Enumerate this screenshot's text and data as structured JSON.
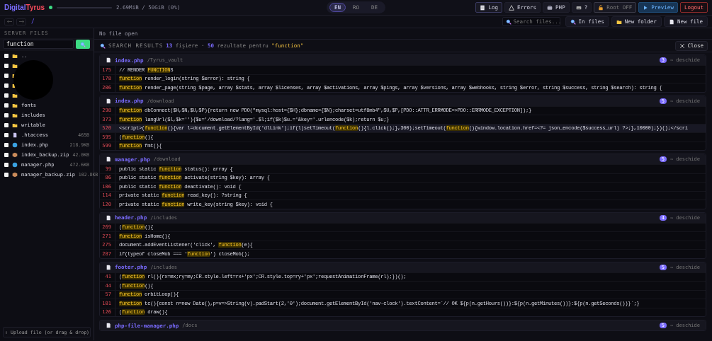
{
  "topbar": {
    "logo": {
      "first": "Digital",
      "second": "Tyrus"
    },
    "status_online": true,
    "storage": {
      "level": 0.0,
      "reading": "2.69MiB / 50GiB (0%)"
    },
    "languages": [
      {
        "label": "EN",
        "selected": true
      },
      {
        "label": "RO",
        "selected": false
      },
      {
        "label": "DE",
        "selected": false
      }
    ],
    "buttons": [
      {
        "label": "Log",
        "kind": "outline"
      },
      {
        "label": "Errors",
        "kind": "plain"
      },
      {
        "label": "PHP",
        "kind": "plain"
      },
      {
        "label": "?",
        "kind": "plain"
      },
      {
        "label": "Root OFF",
        "kind": "muted"
      },
      {
        "label": "Preview",
        "kind": "primary"
      },
      {
        "label": "Logout",
        "kind": "danger"
      }
    ]
  },
  "toolbar": {
    "path": "/",
    "search": {
      "placeholder": "Search files..."
    },
    "buttons": [
      {
        "label": "In files"
      },
      {
        "label": "New folder"
      },
      {
        "label": "New file"
      }
    ]
  },
  "sidebar": {
    "title": "SERVER FILES",
    "search": {
      "value": "function"
    },
    "files": [
      {
        "name": "..",
        "kind": "folder",
        "checked": false
      },
      {
        "kind": "folder",
        "checked": false
      },
      {
        "kind": "folder",
        "checked": false
      },
      {
        "kind": "folder",
        "checked": false
      },
      {
        "kind": "folder",
        "checked": false
      },
      {
        "name": "fonts",
        "kind": "folder",
        "checked": false
      },
      {
        "name": "includes",
        "kind": "folder",
        "checked": false
      },
      {
        "name": "writable",
        "kind": "folder",
        "checked": false
      },
      {
        "name": ".htaccess",
        "kind": "file",
        "size": "465B",
        "checked": false
      },
      {
        "name": "index.php",
        "kind": "php",
        "size": "218.9KB",
        "checked": false
      },
      {
        "name": "index_backup.zip",
        "kind": "zip",
        "size": "42.0KB",
        "checked": false
      },
      {
        "name": "manager.php",
        "kind": "php",
        "size": "472.6KB",
        "checked": false
      },
      {
        "name": "manager_backup.zip",
        "kind": "zip",
        "size": "102.8KB",
        "checked": false
      }
    ],
    "upload": "⇧ Upload file (or drag & drop)"
  },
  "editor": {
    "status": "No file open"
  },
  "search_results": {
    "title": "SEARCH RESULTS",
    "file_count": "13",
    "files_text": "fișiere ·",
    "result_count": "50",
    "results_text": "rezultate pentru",
    "query": "\"function\"",
    "close": "Close",
    "groups": [
      {
        "file": "index.php",
        "path": "/Tyrus_vault",
        "count": "3",
        "open": "→ deschide",
        "lines": [
          {
            "number": "175",
            "selected": false,
            "parts": [
              {
                "text": "// RENDER ",
                "match": false
              },
              {
                "text": "FUNCTION",
                "match": true
              },
              {
                "text": "S",
                "match": false
              }
            ]
          },
          {
            "number": "178",
            "selected": false,
            "parts": [
              {
                "text": "function",
                "match": true
              },
              {
                "text": " render_login(string $error): string {",
                "match": false
              }
            ]
          },
          {
            "number": "206",
            "selected": false,
            "parts": [
              {
                "text": "function",
                "match": true
              },
              {
                "text": " render_page(string $page, array $stats, array $licenses, array $activations, array $pings, array $versions, array $webhooks, string $error, string $success, string $search): string {",
                "match": false
              }
            ]
          }
        ]
      },
      {
        "file": "index.php",
        "path": "/download",
        "count": "5",
        "open": "→ deschide",
        "lines": [
          {
            "number": "298",
            "selected": false,
            "parts": [
              {
                "text": "function",
                "match": true
              },
              {
                "text": " dbConnect($H,$N,$U,$P){return new PDO(\"mysql:host={$H};dbname={$N};charset=utf8mb4\",$U,$P,[PDO::ATTR_ERRMODE=>PDO::ERRMODE_EXCEPTION]);}",
                "match": false
              }
            ]
          },
          {
            "number": "373",
            "selected": false,
            "parts": [
              {
                "text": "function",
                "match": true
              },
              {
                "text": " langUrl($l,$k=''){$u='/download/?lang='.$l;if($k)$u.='&key='.urlencode($k);return $u;}",
                "match": false
              }
            ]
          },
          {
            "number": "520",
            "selected": true,
            "parts": [
              {
                "text": "<script>(",
                "match": false
              },
              {
                "text": "function",
                "match": true
              },
              {
                "text": "(){var l=document.getElementById('dlLink');if(l)setTimeout(",
                "match": false
              },
              {
                "text": "function",
                "match": true
              },
              {
                "text": "(){l.click();},300);setTimeout(",
                "match": false
              },
              {
                "text": "function",
                "match": true
              },
              {
                "text": "(){window.location.href=<?= json_encode($success_url) ?>;},10000);})();</scri",
                "match": false
              }
            ]
          },
          {
            "number": "595",
            "selected": false,
            "parts": [
              {
                "text": "(",
                "match": false
              },
              {
                "text": "function",
                "match": true
              },
              {
                "text": "(){",
                "match": false
              }
            ]
          },
          {
            "number": "599",
            "selected": false,
            "parts": [
              {
                "text": "function",
                "match": true
              },
              {
                "text": " fmt(){",
                "match": false
              }
            ]
          }
        ]
      },
      {
        "file": "manager.php",
        "path": "/download",
        "count": "5",
        "open": "→ deschide",
        "lines": [
          {
            "number": "39",
            "selected": false,
            "parts": [
              {
                "text": "public static ",
                "match": false
              },
              {
                "text": "function",
                "match": true
              },
              {
                "text": " status(): array {",
                "match": false
              }
            ]
          },
          {
            "number": "86",
            "selected": false,
            "parts": [
              {
                "text": "public static ",
                "match": false
              },
              {
                "text": "function",
                "match": true
              },
              {
                "text": " activate(string $key): array {",
                "match": false
              }
            ]
          },
          {
            "number": "106",
            "selected": false,
            "parts": [
              {
                "text": "public static ",
                "match": false
              },
              {
                "text": "function",
                "match": true
              },
              {
                "text": " deactivate(): void {",
                "match": false
              }
            ]
          },
          {
            "number": "114",
            "selected": false,
            "parts": [
              {
                "text": "private static ",
                "match": false
              },
              {
                "text": "function",
                "match": true
              },
              {
                "text": " read_key(): ?string {",
                "match": false
              }
            ]
          },
          {
            "number": "120",
            "selected": false,
            "parts": [
              {
                "text": "private static ",
                "match": false
              },
              {
                "text": "function",
                "match": true
              },
              {
                "text": " write_key(string $key): void {",
                "match": false
              }
            ]
          }
        ]
      },
      {
        "file": "header.php",
        "path": "/includes",
        "count": "4",
        "open": "→ deschide",
        "lines": [
          {
            "number": "269",
            "selected": false,
            "parts": [
              {
                "text": "(",
                "match": false
              },
              {
                "text": "function",
                "match": true
              },
              {
                "text": "(){",
                "match": false
              }
            ]
          },
          {
            "number": "271",
            "selected": false,
            "parts": [
              {
                "text": "function",
                "match": true
              },
              {
                "text": " isHome(){",
                "match": false
              }
            ]
          },
          {
            "number": "275",
            "selected": false,
            "parts": [
              {
                "text": "document.addEventListener('click', ",
                "match": false
              },
              {
                "text": "function",
                "match": true
              },
              {
                "text": "(e){",
                "match": false
              }
            ]
          },
          {
            "number": "287",
            "selected": false,
            "parts": [
              {
                "text": "if(typeof closeMob === '",
                "match": false
              },
              {
                "text": "function",
                "match": true
              },
              {
                "text": "') closeMob();",
                "match": false
              }
            ]
          }
        ]
      },
      {
        "file": "footer.php",
        "path": "/includes",
        "count": "5",
        "open": "→ deschide",
        "lines": [
          {
            "number": "41",
            "selected": false,
            "parts": [
              {
                "text": "(",
                "match": false
              },
              {
                "text": "function",
                "match": true
              },
              {
                "text": " rl(){rx=mx;ry=my;CR.style.left=rx+'px';CR.style.top=ry+'px';requestAnimationFrame(rl);})();",
                "match": false
              }
            ]
          },
          {
            "number": "44",
            "selected": false,
            "parts": [
              {
                "text": "(",
                "match": false
              },
              {
                "text": "function",
                "match": true
              },
              {
                "text": "(){",
                "match": false
              }
            ]
          },
          {
            "number": "57",
            "selected": false,
            "parts": [
              {
                "text": "function",
                "match": true
              },
              {
                "text": " orbitLoop(){",
                "match": false
              }
            ]
          },
          {
            "number": "101",
            "selected": false,
            "parts": [
              {
                "text": "function",
                "match": true
              },
              {
                "text": " tc(){const n=new Date(),p=v=>String(v).padStart(2,'0');document.getElementById('nav-clock').textContent=`// OK ${p(n.getHours())}:${p(n.getMinutes())}:${p(n.getSeconds())}`;}",
                "match": false
              }
            ]
          },
          {
            "number": "126",
            "selected": false,
            "parts": [
              {
                "text": "(",
                "match": false
              },
              {
                "text": "function",
                "match": true
              },
              {
                "text": " draw(){",
                "match": false
              }
            ]
          }
        ]
      },
      {
        "file": "php-file-manager.php",
        "path": "/docs",
        "count": "5",
        "open": "→ deschide"
      }
    ]
  }
}
